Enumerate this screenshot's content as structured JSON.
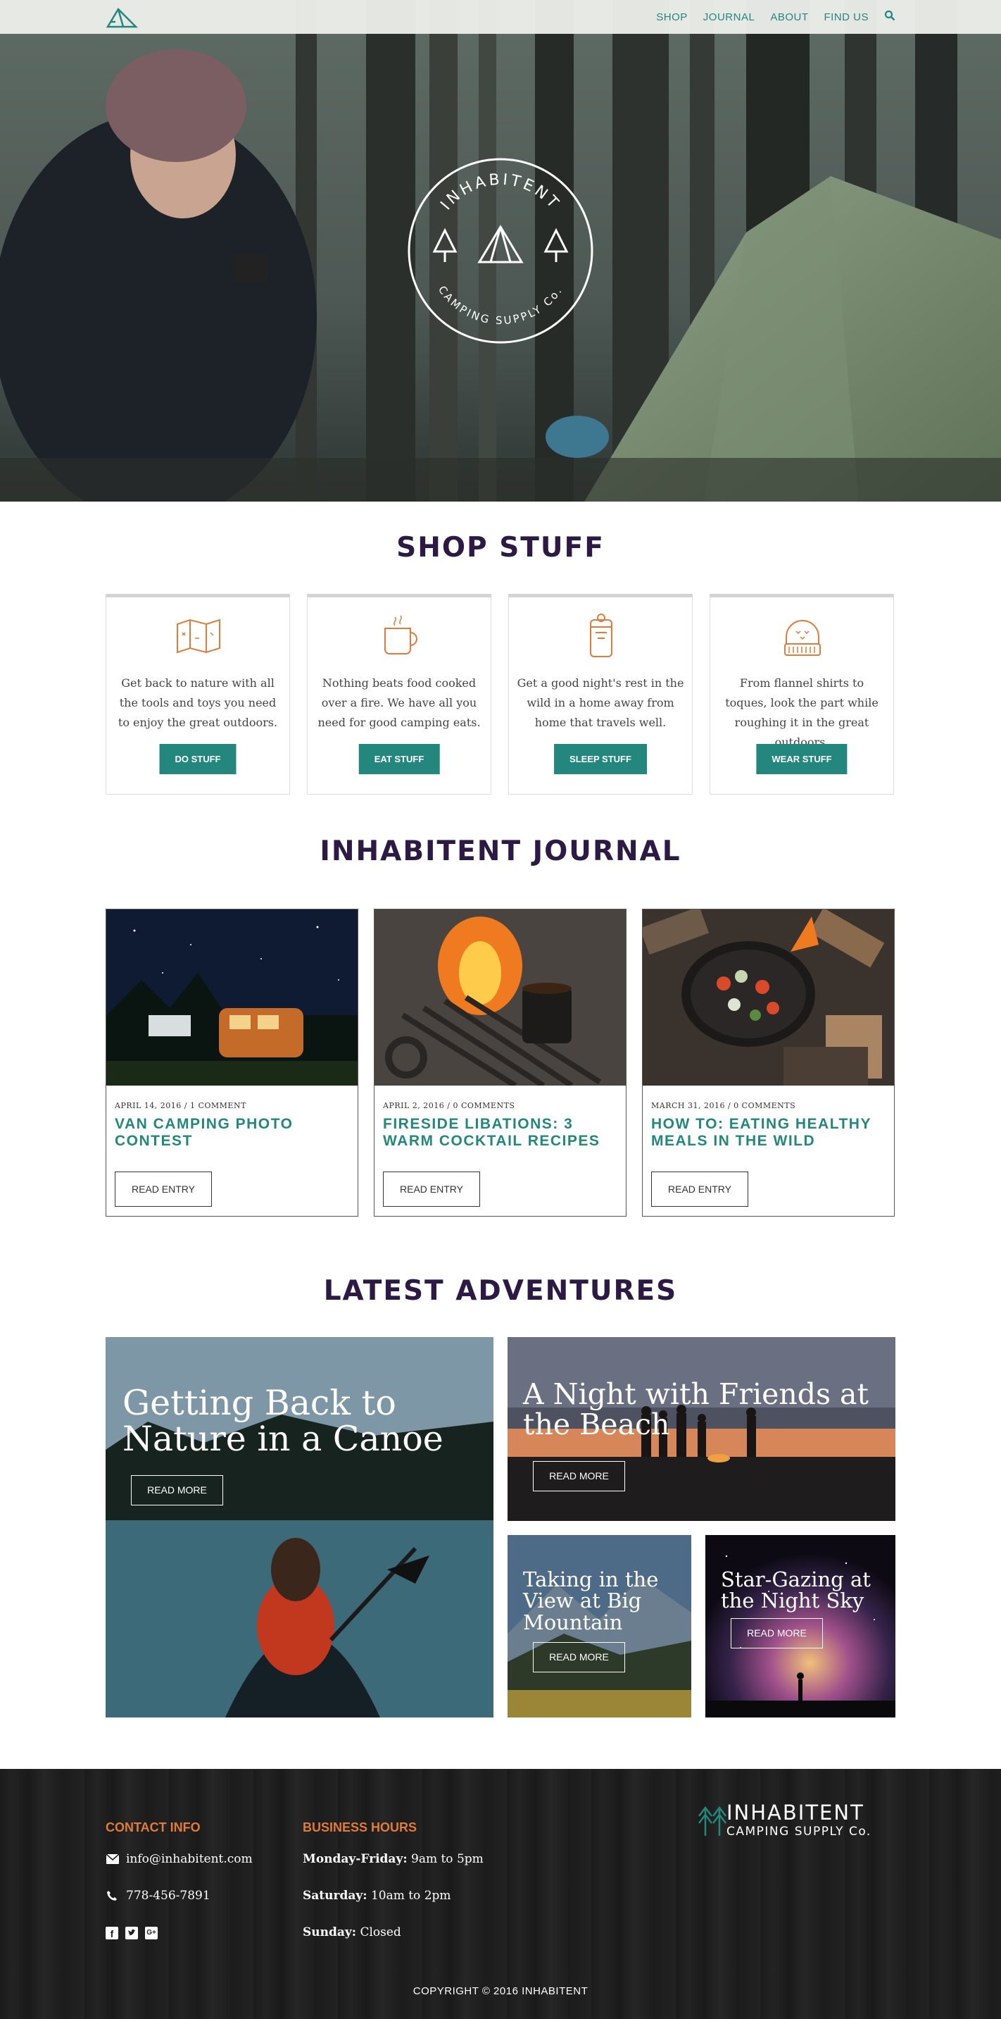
{
  "nav": {
    "items": [
      "SHOP",
      "JOURNAL",
      "ABOUT",
      "FIND US"
    ],
    "logo_icon": "tent-logo-icon",
    "search_icon": "search-icon"
  },
  "hero": {
    "badge_top": "INHABITENT",
    "badge_bottom": "CAMPING SUPPLY Co."
  },
  "shop": {
    "title": "SHOP STUFF",
    "cards": [
      {
        "icon": "map-icon",
        "text": "Get back to nature with all the tools and toys you need to enjoy the great outdoors.",
        "button": "DO STUFF"
      },
      {
        "icon": "mug-icon",
        "text": "Nothing beats food cooked over a fire. We have all you need for good camping eats.",
        "button": "EAT STUFF"
      },
      {
        "icon": "sleeping-bag-icon",
        "text": "Get a good night's rest in the wild in a home away from home that travels well.",
        "button": "SLEEP STUFF"
      },
      {
        "icon": "toque-icon",
        "text": "From flannel shirts to toques, look the part while roughing it in the great outdoors.",
        "button": "WEAR STUFF"
      }
    ]
  },
  "journal": {
    "title": "INHABITENT JOURNAL",
    "entries": [
      {
        "meta": "APRIL 14, 2016 / 1 COMMENT",
        "title": "VAN CAMPING PHOTO CONTEST",
        "button": "READ ENTRY"
      },
      {
        "meta": "APRIL 2, 2016 / 0 COMMENTS",
        "title": "FIRESIDE LIBATIONS: 3 WARM COCKTAIL RECIPES",
        "button": "READ ENTRY"
      },
      {
        "meta": "MARCH 31, 2016 / 0 COMMENTS",
        "title": "HOW TO: EATING HEALTHY MEALS IN THE WILD",
        "button": "READ ENTRY"
      }
    ]
  },
  "adventures": {
    "title": "LATEST ADVENTURES",
    "items": [
      {
        "title": "Getting Back to Nature in a Canoe",
        "button": "READ MORE"
      },
      {
        "title": "A Night with Friends at the Beach",
        "button": "READ MORE"
      },
      {
        "title": "Taking in the View at Big Mountain",
        "button": "READ MORE"
      },
      {
        "title": "Star-Gazing at the Night Sky",
        "button": "READ MORE"
      }
    ]
  },
  "footer": {
    "contact_heading": "CONTACT INFO",
    "email": "info@inhabitent.com",
    "phone": "778-456-7891",
    "hours_heading": "BUSINESS HOURS",
    "hours": [
      {
        "day": "Monday-Friday:",
        "time": "9am to 5pm"
      },
      {
        "day": "Saturday:",
        "time": "10am to 2pm"
      },
      {
        "day": "Sunday:",
        "time": "Closed"
      }
    ],
    "brand_name": "INHABITENT",
    "brand_sub": "CAMPING SUPPLY Co.",
    "social_icons": [
      "facebook-icon",
      "twitter-icon",
      "google-plus-icon"
    ],
    "copyright": "COPYRIGHT © 2016 INHABITENT"
  },
  "colors": {
    "accent": "#24877d",
    "heading": "#2c1a45",
    "footer_heading": "#e07b39"
  }
}
